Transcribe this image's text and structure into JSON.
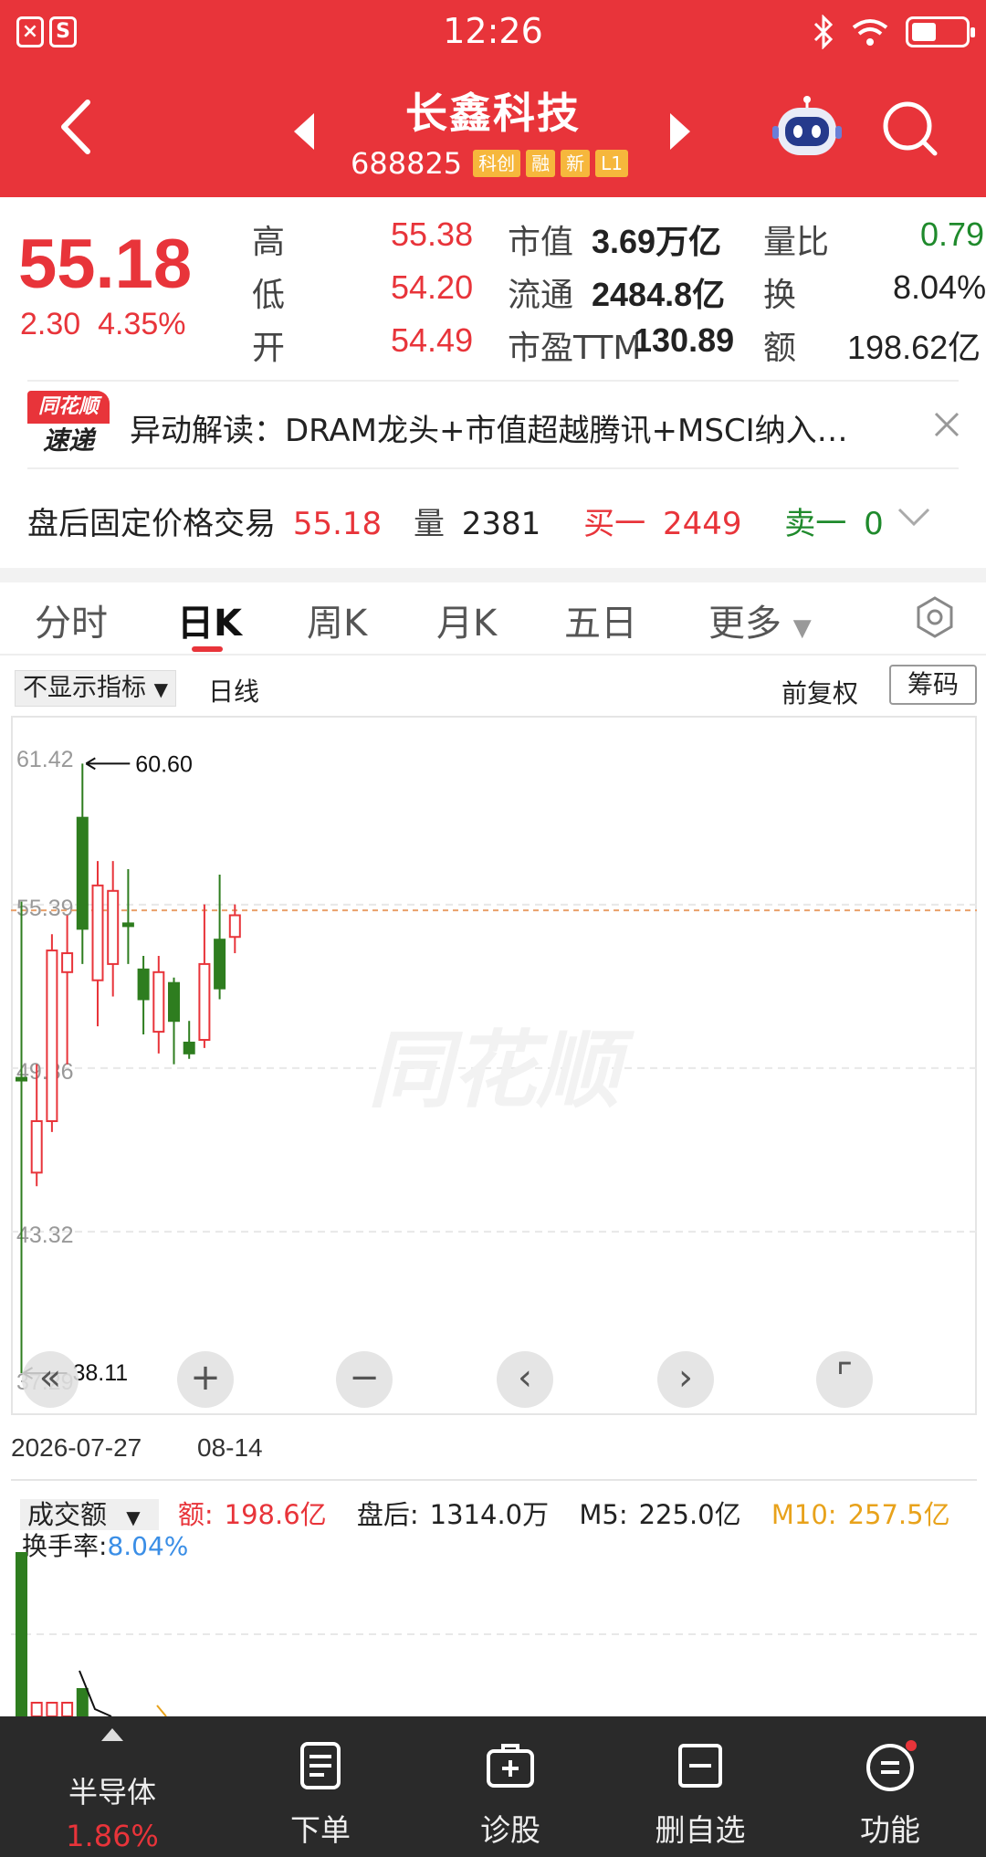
{
  "status_bar": {
    "time": "12:26",
    "left_icons": [
      "close-app-icon",
      "s-app-icon"
    ],
    "right_icons": [
      "bluetooth-icon",
      "wifi-icon",
      "battery-icon"
    ]
  },
  "header": {
    "stock_name": "长鑫科技",
    "stock_code": "688825",
    "tags": [
      "科创",
      "融",
      "新",
      "L1"
    ],
    "icons": [
      "back-icon",
      "prev-stock-icon",
      "next-stock-icon",
      "robot-assistant-icon",
      "search-icon"
    ]
  },
  "quote": {
    "price": "55.18",
    "change": "2.30",
    "change_pct": "4.35%",
    "fields": [
      {
        "label": "高",
        "value": "55.38"
      },
      {
        "label": "低",
        "value": "54.20"
      },
      {
        "label": "开",
        "value": "54.49"
      },
      {
        "label": "市值",
        "value": "3.69万亿"
      },
      {
        "label": "流通",
        "value": "2484.8亿"
      },
      {
        "label": "市盈TTM",
        "value": "130.89"
      },
      {
        "label": "量比",
        "value": "0.79"
      },
      {
        "label": "换",
        "value": "8.04%"
      },
      {
        "label": "额",
        "value": "198.62亿"
      }
    ]
  },
  "alert": {
    "badge_top": "同花顺",
    "badge_bottom": "速递",
    "text": "异动解读：DRAM龙头+市值超越腾讯+MSCI纳入…"
  },
  "post_market": {
    "label": "盘后固定价格交易",
    "price": "55.18",
    "vol_label": "量",
    "vol": "2381",
    "buy_label": "买一",
    "buy": "2449",
    "sell_label": "卖一",
    "sell": "0"
  },
  "tabs": [
    "分时",
    "日K",
    "周K",
    "月K",
    "五日",
    "更多"
  ],
  "active_tab": "日K",
  "chart_controls": {
    "indicator": "不显示指标",
    "line": "日线",
    "adjust": "前复权",
    "chips": "筹码"
  },
  "chart_data": {
    "type": "candlestick",
    "y_ticks": [
      "61.42",
      "55.39",
      "49.36",
      "43.32",
      "37.29"
    ],
    "ylim": [
      37.29,
      61.42
    ],
    "max_label": "60.60",
    "min_label": "38.11",
    "last_price": 55.18,
    "x_labels": [
      "2026-07-27",
      "08-14"
    ],
    "watermark": "同花顺",
    "candles": [
      {
        "o": 49.0,
        "c": 49.0,
        "h": 55.5,
        "l": 38.1,
        "up": false
      },
      {
        "o": 47.4,
        "c": 45.5,
        "h": 49.5,
        "l": 45.0,
        "up": true
      },
      {
        "o": 53.7,
        "c": 47.4,
        "h": 54.3,
        "l": 47.0,
        "up": true
      },
      {
        "o": 53.6,
        "c": 52.9,
        "h": 55.0,
        "l": 49.5,
        "up": true
      },
      {
        "o": 54.5,
        "c": 58.6,
        "h": 60.6,
        "l": 53.2,
        "up": false
      },
      {
        "o": 52.6,
        "c": 56.1,
        "h": 57.0,
        "l": 50.9,
        "up": true
      },
      {
        "o": 53.2,
        "c": 55.9,
        "h": 57.0,
        "l": 52.0,
        "up": true
      },
      {
        "o": 54.7,
        "c": 54.6,
        "h": 56.7,
        "l": 53.2,
        "up": false
      },
      {
        "o": 53.0,
        "c": 51.9,
        "h": 53.5,
        "l": 50.6,
        "up": false
      },
      {
        "o": 50.7,
        "c": 52.9,
        "h": 53.5,
        "l": 49.9,
        "up": true
      },
      {
        "o": 52.5,
        "c": 51.1,
        "h": 52.7,
        "l": 49.5,
        "up": false
      },
      {
        "o": 50.3,
        "c": 49.9,
        "h": 51.1,
        "l": 49.7,
        "up": false
      },
      {
        "o": 50.4,
        "c": 53.2,
        "h": 55.4,
        "l": 50.1,
        "up": true
      },
      {
        "o": 54.1,
        "c": 52.3,
        "h": 56.5,
        "l": 51.9,
        "up": false
      },
      {
        "o": 54.2,
        "c": 55.0,
        "h": 55.4,
        "l": 53.6,
        "up": true
      }
    ]
  },
  "zoom_controls": [
    "«",
    "+",
    "−",
    "‹",
    "›",
    "⌜"
  ],
  "volume": {
    "selector": "成交额",
    "amount_label": "额:",
    "amount": "198.6亿",
    "after_label": "盘后:",
    "after": "1314.0万",
    "m5_label": "M5:",
    "m5": "225.0亿",
    "m10_label": "M10:",
    "m10": "257.5亿",
    "turnover_label": "换手率:",
    "turnover": "8.04%"
  },
  "bottom_nav": {
    "sector": "半导体",
    "sector_pct": "1.86%",
    "items": [
      "下单",
      "诊股",
      "删自选",
      "功能"
    ]
  },
  "colors": {
    "brand_red": "#e8343a",
    "up_red": "#e8343a",
    "down_green": "#2e7d1f",
    "bottom_bar": "#2a2a2a"
  }
}
